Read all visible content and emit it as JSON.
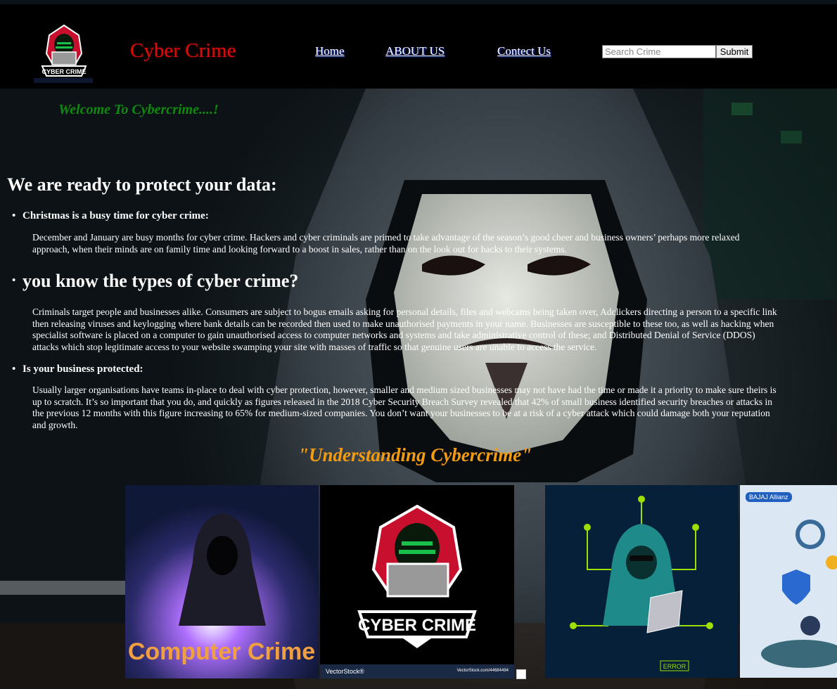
{
  "header": {
    "brand": "Cyber Crime",
    "logo_text": "CYBER CRIME",
    "nav": [
      {
        "label": "Home"
      },
      {
        "label": "ABOUT US"
      },
      {
        "label": "Contect Us"
      }
    ],
    "search": {
      "placeholder": "Search Crime",
      "value": "",
      "submit_label": "Submit"
    }
  },
  "hero": {
    "welcome": "Welcome To Cybercrime....!",
    "heading": "We are ready to protect your data:",
    "sections": [
      {
        "title": "Christmas is a busy time for cyber crime:",
        "lines": [
          "December and January are busy months for cyber crime. Hackers and cyber criminals are primed to take advantage of the season’s good cheer and business owners’ perhaps more relaxed",
          "approach, when their minds are on family time and looking forward to a boost in sales, rather than on the look out for hacks to their systems."
        ]
      },
      {
        "title": "you know the types of cyber crime?",
        "lines": [
          "Criminals target people and businesses alike. Consumers are subject to bogus emails asking for personal details, files and webcams being taken over, Adclickers directing a person to a specific link",
          "then releasing viruses and keylogging where bank details can be recorded then used to make unauthorised payments in your name. Businesses are susceptible to these too, as well as hacking when",
          "specialist software is placed on a computer to gain unauthorised access to computer networks and systems and take administrative control of these; and Distributed Denial of Service (DDOS)",
          "attacks which stop legitimate access to your website swamping your site with masses of traffic so that genuine users are unable to access the service."
        ]
      },
      {
        "title": "Is your business protected:",
        "lines": [
          "Usually larger organisations have teams in-place to deal with cyber protection, however, smaller and medium sized businesses may not have had the time or made it a priority to make sure theirs is",
          "up to scratch. It’s so important that you do, and quickly as figures released in the 2018 Cyber Security Breach Survey revealed that 42% of small business identified security breaches or attacks in",
          "the previous 12 months with this figure increasing to 65% for medium-sized companies. You don’t want your businesses to be at a risk of a cyber attack which could damage both your reputation",
          "and growth."
        ]
      }
    ],
    "understanding": "\"Understanding Cybercrime\""
  },
  "gallery": {
    "tile1_text": "Computer Crime",
    "tile2_text": "CYBER CRIME",
    "tile2_caption_left": "VectorStock®",
    "tile2_caption_right": "VectorStock.com/44684494",
    "tile3_label": "ERROR",
    "tile4_tag": "BAJAJ Allianz"
  },
  "colors": {
    "brand": "#e10a0a",
    "welcome": "#0f8a0f",
    "understanding": "#f39c12"
  }
}
